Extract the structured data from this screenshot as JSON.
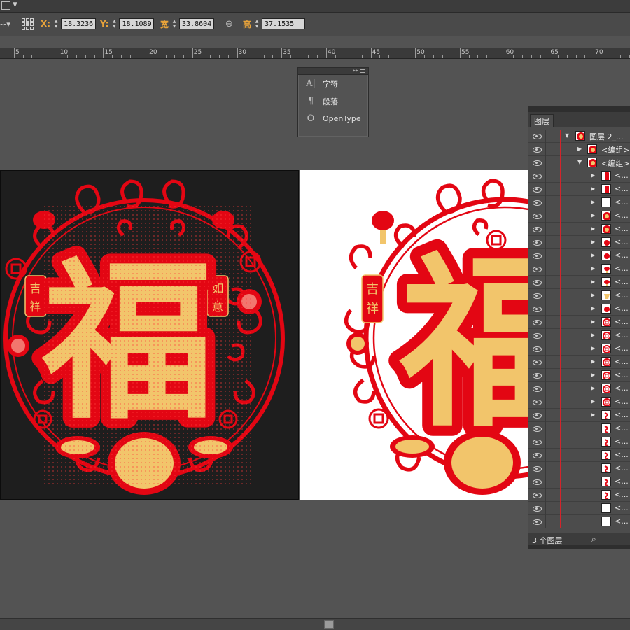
{
  "control_bar": {
    "x_label": "X:",
    "x_value": "18.3236",
    "y_label": "Y:",
    "y_value": "18.1089",
    "width_label": "宽",
    "width_value": "33.8604",
    "height_label": "高",
    "height_value": "37.1535"
  },
  "ruler": {
    "ticks": [
      "5",
      "10",
      "15",
      "20",
      "25",
      "30",
      "35",
      "40",
      "45",
      "50",
      "55",
      "60",
      "65",
      "70"
    ]
  },
  "character_panel": {
    "items": [
      {
        "icon": "character-icon",
        "label": "字符"
      },
      {
        "icon": "paragraph-icon",
        "label": "段落"
      },
      {
        "icon": "opentype-icon",
        "label": "OpenType"
      }
    ]
  },
  "artwork": {
    "main_char": "福",
    "left_tag": [
      "吉",
      "祥"
    ],
    "right_tag": [
      "如",
      "意"
    ],
    "red": "#e30613",
    "gold": "#f2c56b",
    "dark_bg": "#1e1e1e"
  },
  "layers_panel": {
    "tab_label": "图层",
    "top_layer_name": "图层 2_...",
    "group_label": "<编组>",
    "collapsed_label": "<...",
    "footer_count": "3 个图层"
  }
}
